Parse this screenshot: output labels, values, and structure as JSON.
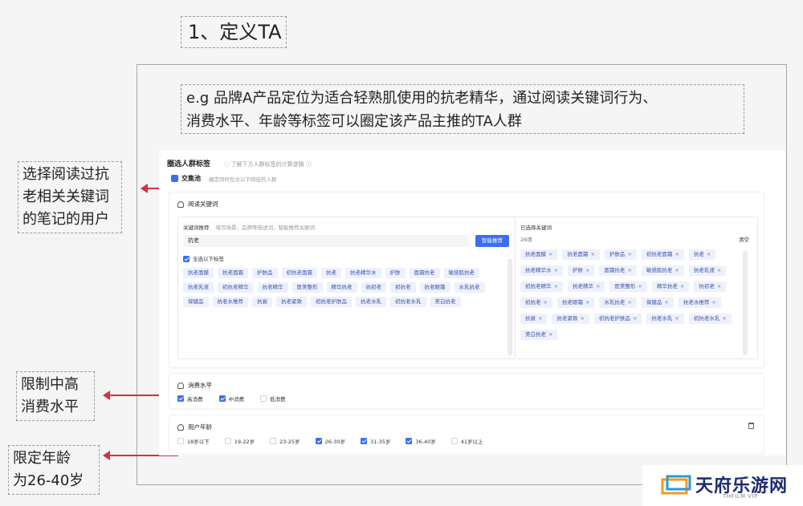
{
  "slide": {
    "title": "1、定义TA",
    "description_line1": "e.g 品牌A产品定位为适合轻熟肌使用的抗老精华，通过阅读关键词行为、",
    "description_line2": "消费水平、年龄等标签可以圈定该产品主推的TA人群"
  },
  "annotations": {
    "keywords_line1": "选择阅读过抗",
    "keywords_line2": "老相关关键词",
    "keywords_line3": "的笔记的用户",
    "consumption_line1": "限制中高",
    "consumption_line2": "消费水平",
    "age_line1": "限定年龄",
    "age_line2": "为26-40岁",
    "arrow_color": "#d9303a"
  },
  "ui": {
    "header": {
      "title": "圈选人群标签",
      "hint": "了解下方人群标签的计算逻辑"
    },
    "tab": {
      "label": "交集池",
      "hint": "圈定同时包含以下特征的人群"
    },
    "accent_color": "#3b6ef5",
    "reading_keywords": {
      "section_title": "阅读关键词",
      "recommend_label": "关键词推荐",
      "recommend_hint": "填写场景、品牌等描述词，智能推荐关联词",
      "search_value": "抗老",
      "smart_button": "智能推荐",
      "select_all_label": "全选以下标签",
      "recommended_tags": [
        "抗老面膜",
        "抗老面霜",
        "护肤品",
        "初抗老面霜",
        "抗老",
        "抗老精华水",
        "护肤",
        "面霜抗老",
        "敏感肌抗老",
        "抗老乳液",
        "初抗老精华",
        "抗老精华",
        "医美整形",
        "精华抗老",
        "抗初老",
        "初抗老",
        "抗老眼霜",
        "水乳抗老",
        "保健品",
        "抗老水推荐",
        "抗衰",
        "抗老紧致",
        "初抗老护肤品",
        "抗老水乳",
        "初抗老水乳",
        "美白抗老"
      ],
      "selected_label": "已选择关键词",
      "selected_count": "26项",
      "clear_label": "清空",
      "remove_glyph": "×",
      "selected_tags": [
        "抗老面膜",
        "抗老面霜",
        "护肤品",
        "初抗老面霜",
        "抗老",
        "抗老精华水",
        "护肤",
        "面霜抗老",
        "敏感肌抗老",
        "抗老乳液",
        "初抗老精华",
        "抗老精华",
        "医美整形",
        "精华抗老",
        "抗初老",
        "初抗老",
        "抗老眼霜",
        "水乳抗老",
        "保健品",
        "抗老水推荐",
        "抗衰",
        "抗老紧致",
        "初抗老护肤品",
        "抗老水乳",
        "初抗老水乳",
        "美白抗老"
      ]
    },
    "consumption": {
      "section_title": "消费水平",
      "options": [
        {
          "label": "高消费",
          "checked": true
        },
        {
          "label": "中消费",
          "checked": true
        },
        {
          "label": "低消费",
          "checked": false
        }
      ]
    },
    "age": {
      "section_title": "用户年龄",
      "options": [
        {
          "label": "18岁以下",
          "checked": false
        },
        {
          "label": "19-22岁",
          "checked": false
        },
        {
          "label": "23-25岁",
          "checked": false
        },
        {
          "label": "26-30岁",
          "checked": true
        },
        {
          "label": "31-35岁",
          "checked": true
        },
        {
          "label": "36-40岁",
          "checked": true
        },
        {
          "label": "41岁以上",
          "checked": false
        }
      ]
    }
  },
  "watermark": {
    "title": "天府乐游网",
    "subtitle": "THFILM VIP"
  }
}
